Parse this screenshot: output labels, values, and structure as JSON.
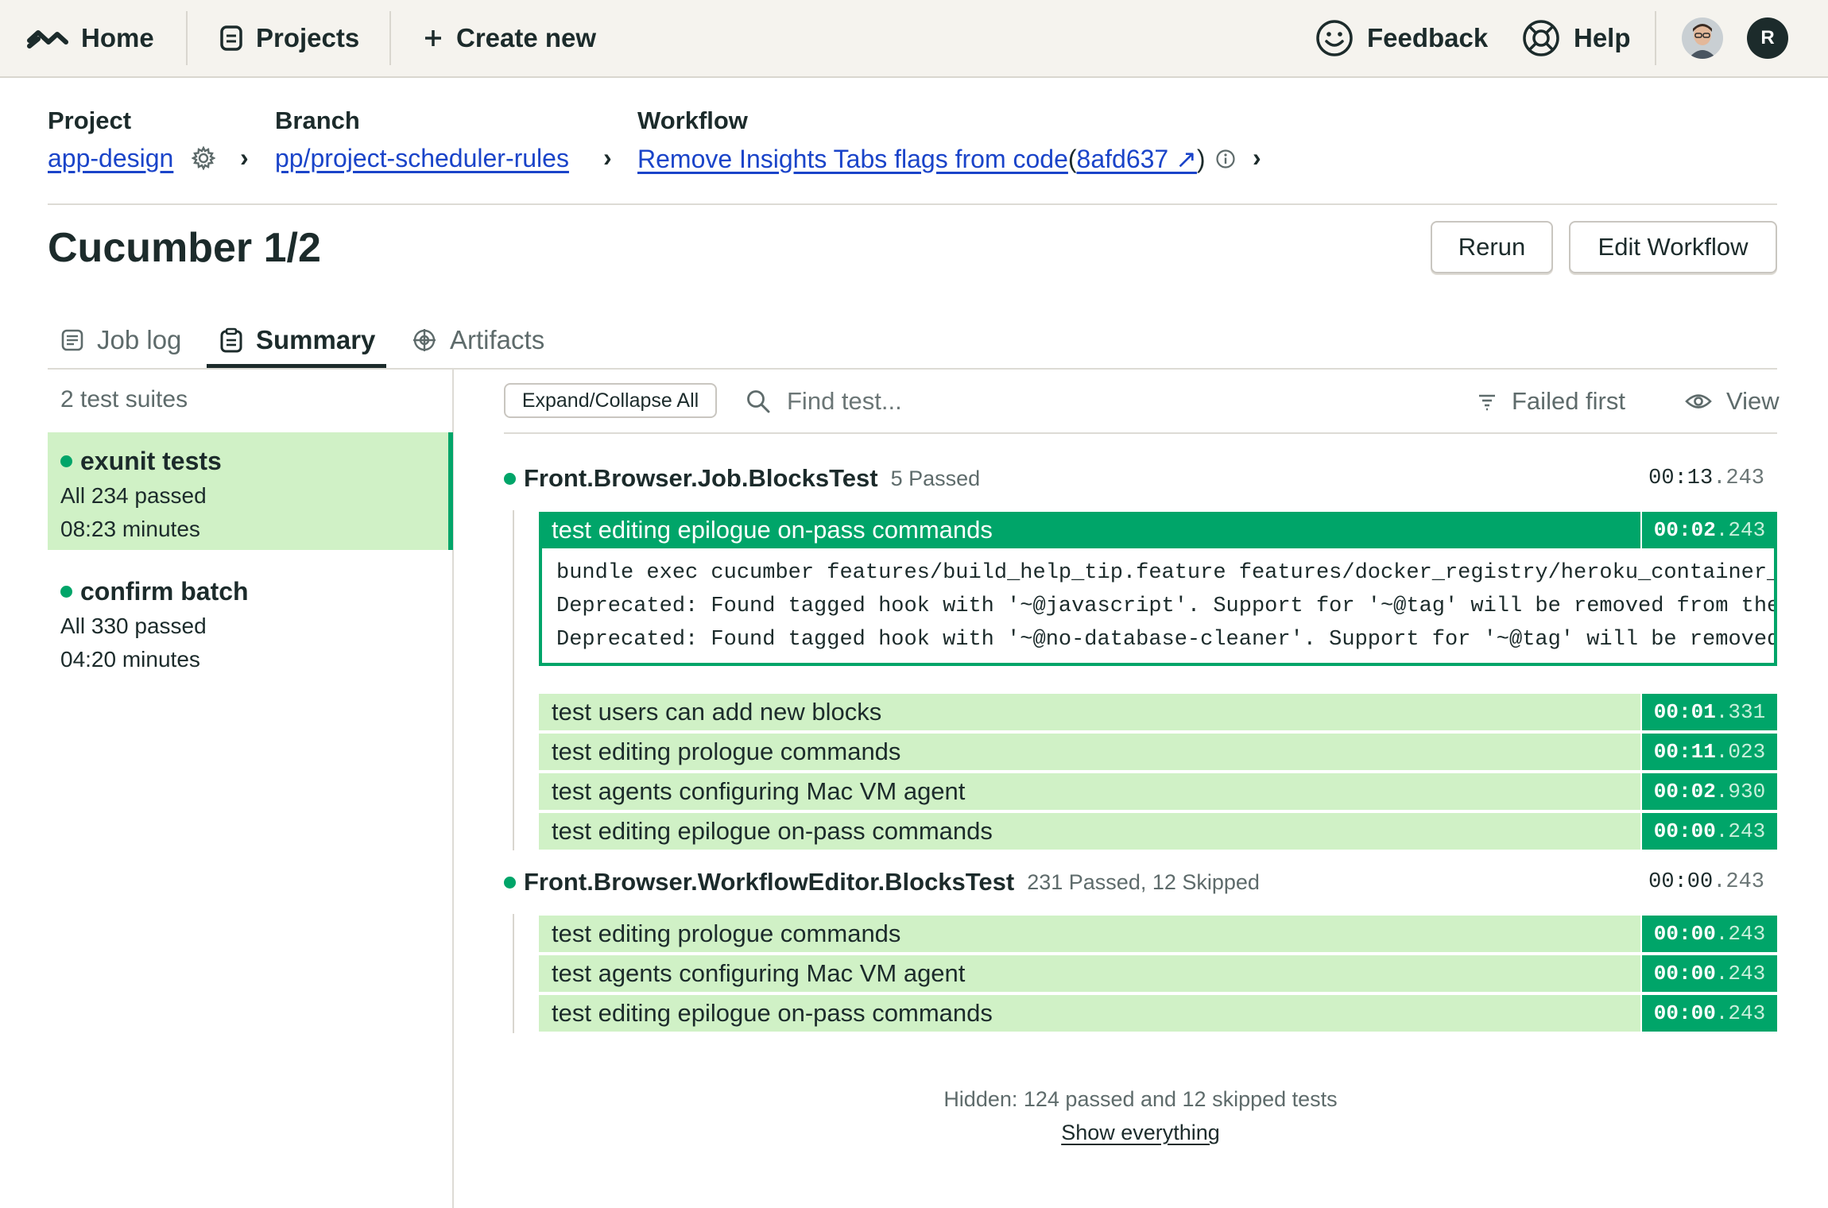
{
  "nav": {
    "home": "Home",
    "projects": "Projects",
    "create_new": "Create new",
    "feedback": "Feedback",
    "help": "Help",
    "avatar_letter": "R"
  },
  "breadcrumb": {
    "project_label": "Project",
    "project_value": "app-design",
    "branch_label": "Branch",
    "branch_value": "pp/project-scheduler-rules",
    "workflow_label": "Workflow",
    "workflow_value": "Remove Insights Tabs flags from code",
    "commit": "8afd637 ↗",
    "paren_open": "(",
    "paren_close": ")",
    "arrow": "›"
  },
  "page": {
    "title": "Cucumber 1/2",
    "rerun": "Rerun",
    "edit_workflow": "Edit Workflow"
  },
  "tabs": [
    {
      "label": "Job log"
    },
    {
      "label": "Summary"
    },
    {
      "label": "Artifacts"
    }
  ],
  "sidebar": {
    "count": "2 test suites",
    "suites": [
      {
        "name": "exunit tests",
        "status": "All 234 passed",
        "duration": "08:23 minutes"
      },
      {
        "name": "confirm batch",
        "status": "All 330 passed",
        "duration": "04:20 minutes"
      }
    ]
  },
  "toolbar": {
    "expand": "Expand/Collapse All",
    "find_placeholder": "Find test...",
    "sort": "Failed first",
    "view": "View"
  },
  "groups": [
    {
      "name": "Front.Browser.Job.BlocksTest",
      "count": "5 Passed",
      "time_main": "00:13",
      "time_ms": ".243",
      "expanded_test": {
        "name": "test editing epilogue on-pass commands",
        "time_main": "00:02",
        "time_ms": ".243",
        "log": [
          "bundle exec cucumber features/build_help_tip.feature features/docker_registry/heroku_container_registry.feature",
          "Deprecated: Found tagged hook with '~@javascript'. Support for '~@tag' will be removed from the next release",
          "Deprecated: Found tagged hook with '~@no-database-cleaner'. Support for '~@tag' will be removed from the next"
        ]
      },
      "tests": [
        {
          "name": "test users can add new blocks",
          "time_main": "00:01",
          "time_ms": ".331"
        },
        {
          "name": "test editing prologue commands",
          "time_main": "00:11",
          "time_ms": ".023"
        },
        {
          "name": "test agents configuring Mac VM agent",
          "time_main": "00:02",
          "time_ms": ".930"
        },
        {
          "name": "test editing epilogue on-pass commands",
          "time_main": "00:00",
          "time_ms": ".243"
        }
      ]
    },
    {
      "name": "Front.Browser.WorkflowEditor.BlocksTest",
      "count": "231 Passed, 12 Skipped",
      "time_main": "00:00",
      "time_ms": ".243",
      "tests": [
        {
          "name": "test editing prologue commands",
          "time_main": "00:00",
          "time_ms": ".243"
        },
        {
          "name": "test agents configuring Mac VM agent",
          "time_main": "00:00",
          "time_ms": ".243"
        },
        {
          "name": "test editing epilogue on-pass commands",
          "time_main": "00:00",
          "time_ms": ".243"
        }
      ]
    }
  ],
  "footer": {
    "hidden": "Hidden: 124 passed and 12 skipped tests",
    "show_everything": "Show everything"
  },
  "colors": {
    "accent_green": "#00a569",
    "row_green": "#d0f1c6",
    "link_blue": "#1a44c9",
    "nav_bg": "#f5f3ee"
  }
}
